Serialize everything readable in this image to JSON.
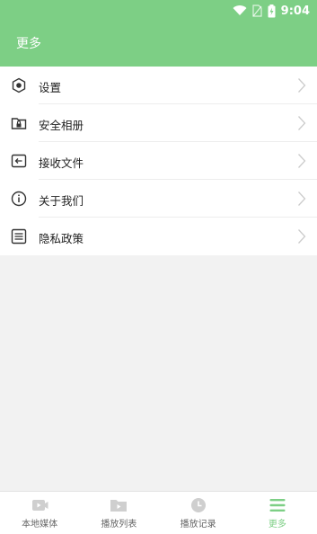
{
  "status_bar": {
    "time": "9:04"
  },
  "header": {
    "title": "更多"
  },
  "menu": {
    "items": [
      {
        "label": "设置",
        "icon": "gear-hex-icon"
      },
      {
        "label": "安全相册",
        "icon": "locked-folder-icon"
      },
      {
        "label": "接收文件",
        "icon": "receive-file-icon"
      },
      {
        "label": "关于我们",
        "icon": "info-icon"
      },
      {
        "label": "隐私政策",
        "icon": "document-list-icon"
      }
    ]
  },
  "bottom_nav": {
    "items": [
      {
        "label": "本地媒体",
        "icon": "video-icon"
      },
      {
        "label": "播放列表",
        "icon": "playlist-folder-icon"
      },
      {
        "label": "播放记录",
        "icon": "clock-icon"
      },
      {
        "label": "更多",
        "icon": "menu-icon"
      }
    ],
    "active_color": "#7dcf85",
    "inactive_color": "#cfcfcf"
  },
  "colors": {
    "header": "#7dcf85"
  }
}
